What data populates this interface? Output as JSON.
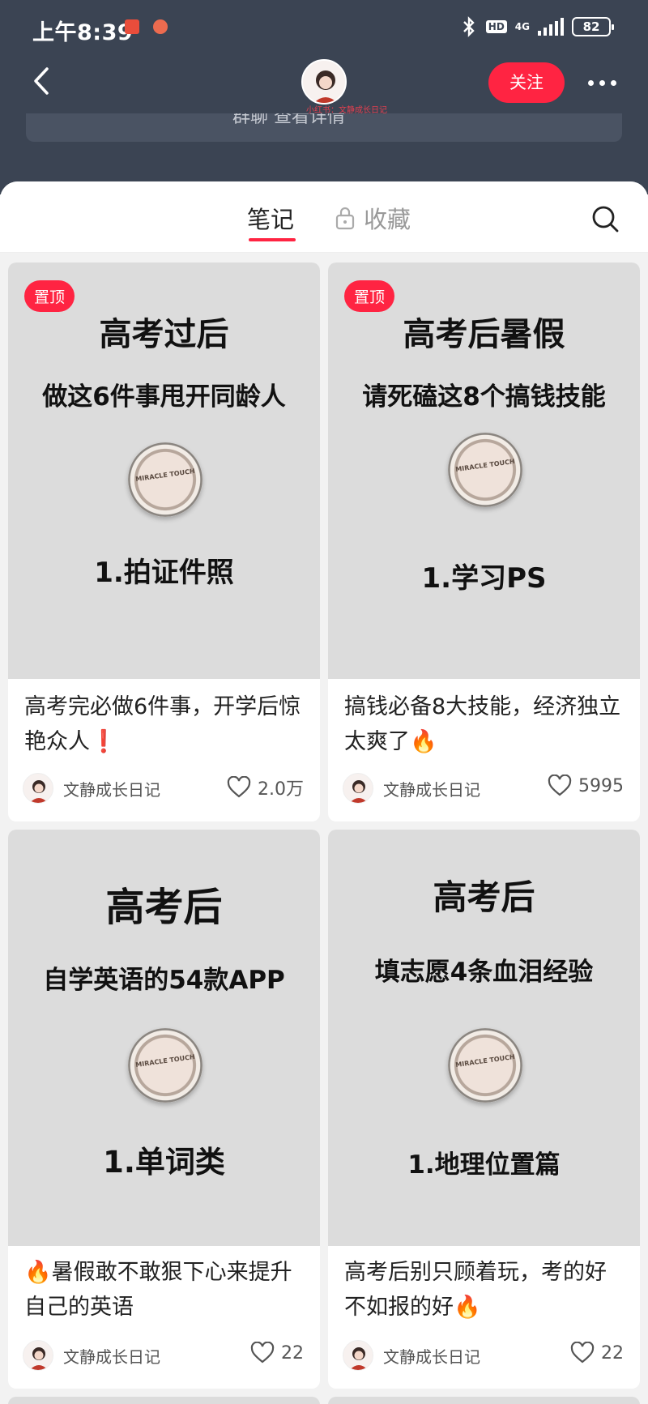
{
  "status_bar": {
    "time": "上午8:39",
    "hd": "HD",
    "network": "4G",
    "battery": "82"
  },
  "nav": {
    "subtitle": "小红书：文静成长日记",
    "follow_label": "关注"
  },
  "group_strip": {
    "text": "群聊  查看详情"
  },
  "tabs": {
    "notes_label": "笔记",
    "favorites_label": "收藏"
  },
  "cards": [
    {
      "pin_label": "置顶",
      "cover_title": "高考过后",
      "cover_subtitle": "做这6件事甩开同龄人",
      "cover_step": "1.拍证件照",
      "product_text": "MIRACLE TOUCH",
      "title": "高考完必做6件事，开学后惊艳众人❗",
      "author": "文静成长日记",
      "likes": "2.0万"
    },
    {
      "pin_label": "置顶",
      "cover_title": "高考后暑假",
      "cover_subtitle": "请死磕这8个搞钱技能",
      "cover_step": "1.学习PS",
      "product_text": "MIRACLE TOUCH",
      "title": "搞钱必备8大技能，经济独立太爽了🔥",
      "author": "文静成长日记",
      "likes": "5995"
    },
    {
      "cover_title": "高考后",
      "cover_subtitle": "自学英语的54款APP",
      "cover_step": "1.单词类",
      "product_text": "MIRACLE TOUCH",
      "title": "🔥暑假敢不敢狠下心来提升自己的英语",
      "author": "文静成长日记",
      "likes": "22"
    },
    {
      "cover_title": "高考后",
      "cover_subtitle": "填志愿4条血泪经验",
      "cover_step": "1.地理位置篇",
      "product_text": "MIRACLE TOUCH",
      "title": "高考后别只顾着玩，考的好不如报的好🔥",
      "author": "文静成长日记",
      "likes": "22"
    }
  ],
  "icons": [
    "back-icon",
    "more-icon",
    "lock-icon",
    "search-icon",
    "heart-icon",
    "bluetooth-icon",
    "signal-icon",
    "battery-icon"
  ]
}
